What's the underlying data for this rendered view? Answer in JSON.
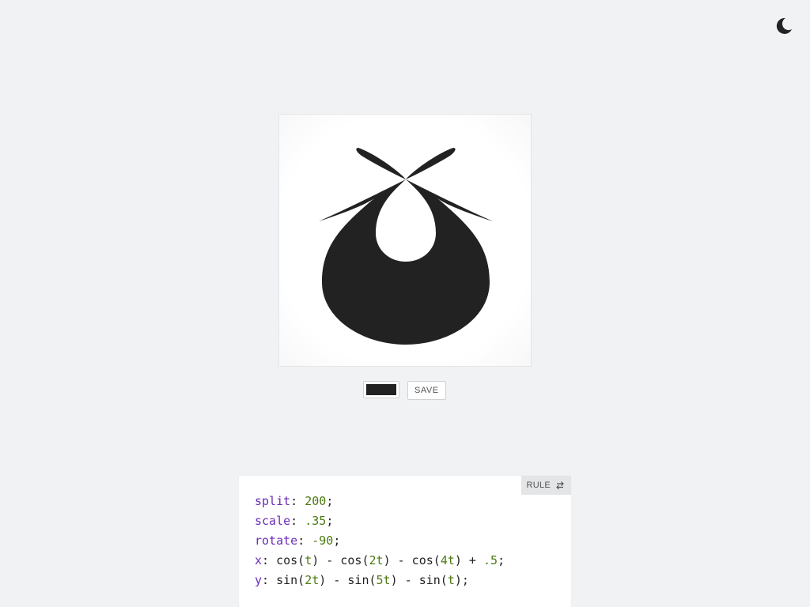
{
  "theme_toggle": {
    "icon": "moon-icon"
  },
  "canvas": {
    "fill_color": "#222222",
    "background": "#ffffff"
  },
  "controls": {
    "color_value": "#222222",
    "save_label": "SAVE"
  },
  "rule_panel": {
    "rule_label": "RULE",
    "rule_icon": "swap-icon",
    "lines": [
      {
        "key": "split",
        "parts": [
          {
            "t": "num",
            "v": "200"
          },
          {
            "t": "plain",
            "v": ";"
          }
        ]
      },
      {
        "key": "scale",
        "parts": [
          {
            "t": "num",
            "v": ".35"
          },
          {
            "t": "plain",
            "v": ";"
          }
        ]
      },
      {
        "key": "rotate",
        "parts": [
          {
            "t": "num",
            "v": "-90"
          },
          {
            "t": "plain",
            "v": ";"
          }
        ]
      },
      {
        "key": "x",
        "parts": [
          {
            "t": "plain",
            "v": "cos("
          },
          {
            "t": "num",
            "v": "t"
          },
          {
            "t": "plain",
            "v": ") - cos("
          },
          {
            "t": "num",
            "v": "2t"
          },
          {
            "t": "plain",
            "v": ") - cos("
          },
          {
            "t": "num",
            "v": "4t"
          },
          {
            "t": "plain",
            "v": ") + "
          },
          {
            "t": "num",
            "v": ".5"
          },
          {
            "t": "plain",
            "v": ";"
          }
        ]
      },
      {
        "key": "y",
        "parts": [
          {
            "t": "plain",
            "v": "sin("
          },
          {
            "t": "num",
            "v": "2t"
          },
          {
            "t": "plain",
            "v": ") - sin("
          },
          {
            "t": "num",
            "v": "5t"
          },
          {
            "t": "plain",
            "v": ") - sin("
          },
          {
            "t": "num",
            "v": "t"
          },
          {
            "t": "plain",
            "v": ");"
          }
        ]
      }
    ]
  }
}
